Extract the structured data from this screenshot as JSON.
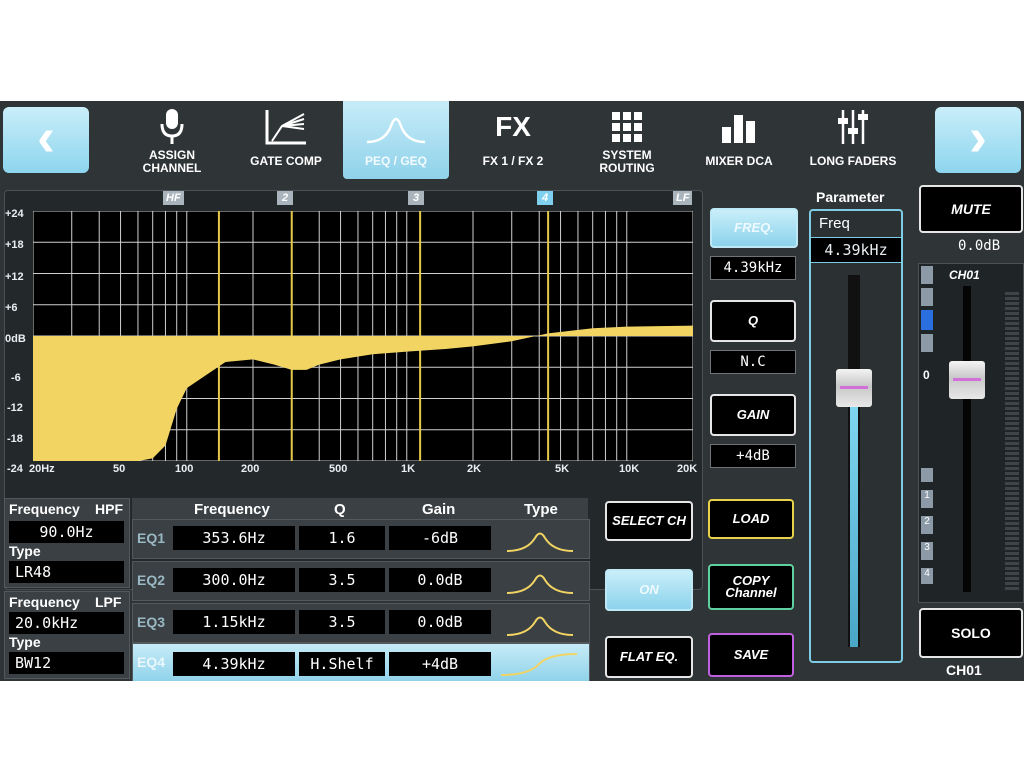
{
  "nav": {
    "back_glyph": "‹",
    "forward_glyph": "›",
    "tabs": [
      {
        "label_1": "ASSIGN",
        "label_2": "CHANNEL",
        "icon": "microphone-icon"
      },
      {
        "label_1": "GATE COMP",
        "label_2": "",
        "icon": "gate-comp-icon"
      },
      {
        "label_1": "PEQ / GEQ",
        "label_2": "",
        "icon": "peq-curve-icon"
      },
      {
        "label_1": "FX 1 / FX 2",
        "label_2": "",
        "icon_text": "FX"
      },
      {
        "label_1": "SYSTEM",
        "label_2": "ROUTING",
        "icon": "grid-icon"
      },
      {
        "label_1": "MIXER DCA",
        "label_2": "",
        "icon": "bar-chart-icon"
      },
      {
        "label_1": "LONG FADERS",
        "label_2": "",
        "icon": "faders-icon"
      }
    ]
  },
  "graph": {
    "markers": [
      "HF",
      "2",
      "3",
      "4",
      "LF"
    ],
    "y_ticks": [
      "+24",
      "+18",
      "+12",
      "+6",
      "0dB",
      "-6",
      "-12",
      "-18",
      "-24"
    ],
    "x_ticks": [
      "20Hz",
      "50",
      "100",
      "200",
      "500",
      "1K",
      "2K",
      "5K",
      "10K",
      "20K"
    ],
    "curve_color": "#f2d463"
  },
  "chart_data": {
    "type": "area",
    "xlabel": "",
    "ylabel": "",
    "x_scale": "log",
    "xlim": [
      20,
      20000
    ],
    "ylim": [
      -24,
      24
    ],
    "grid": true,
    "x": [
      20,
      30,
      40,
      50,
      60,
      70,
      80,
      90,
      100,
      150,
      200,
      250,
      300,
      350,
      400,
      500,
      700,
      1000,
      1500,
      2000,
      3000,
      4390,
      7000,
      10000,
      20000
    ],
    "series": [
      {
        "values": [
          -24,
          -24,
          -24,
          -24,
          -24,
          -23.5,
          -21,
          -14,
          -10,
          -5,
          -4.5,
          -5.5,
          -6.5,
          -6.5,
          -5.5,
          -4.5,
          -3.5,
          -3,
          -2.5,
          -2,
          -1,
          0.5,
          1.5,
          1.8,
          2
        ]
      }
    ]
  },
  "side_controls": {
    "freq_label": "FREQ.",
    "freq_value": "4.39kHz",
    "q_label": "Q",
    "q_value": "N.C",
    "gain_label": "GAIN",
    "gain_value": "+4dB"
  },
  "filters": {
    "hpf_freq_label": "Frequency",
    "hpf_tag": "HPF",
    "hpf_freq": "90.0Hz",
    "hpf_type_label": "Type",
    "hpf_type": "LR48",
    "lpf_freq_label": "Frequency",
    "lpf_tag": "LPF",
    "lpf_freq": "20.0kHz",
    "lpf_type_label": "Type",
    "lpf_type": "BW12"
  },
  "eq_table": {
    "headers": [
      "Frequency",
      "Q",
      "Gain",
      "Type"
    ],
    "rows": [
      {
        "band": "EQ1",
        "freq": "353.6Hz",
        "q": "1.6",
        "gain": "-6dB",
        "type_icon": "bell-icon"
      },
      {
        "band": "EQ2",
        "freq": "300.0Hz",
        "q": "3.5",
        "gain": "0.0dB",
        "type_icon": "bell-icon"
      },
      {
        "band": "EQ3",
        "freq": "1.15kHz",
        "q": "3.5",
        "gain": "0.0dB",
        "type_icon": "bell-icon"
      },
      {
        "band": "EQ4",
        "freq": "4.39kHz",
        "q": "H.Shelf",
        "gain": "+4dB",
        "type_icon": "high-shelf-icon"
      }
    ]
  },
  "actions": {
    "select_ch": "SELECT CH",
    "on": "ON",
    "flat_eq": "FLAT EQ.",
    "load": "LOAD",
    "copy_1": "COPY",
    "copy_2": "Channel",
    "save": "SAVE"
  },
  "parameter": {
    "title": "Parameter",
    "name": "Freq",
    "value": "4.39kHz",
    "level": 0.72
  },
  "channel": {
    "mute": "MUTE",
    "gain_readout": "0.0dB",
    "strip_name": "CH01",
    "zero_mark": "0",
    "dca_numbers": [
      "1",
      "2",
      "3",
      "4"
    ],
    "solo": "SOLO",
    "bottom_name": "CH01",
    "fader_level": 0.72
  }
}
